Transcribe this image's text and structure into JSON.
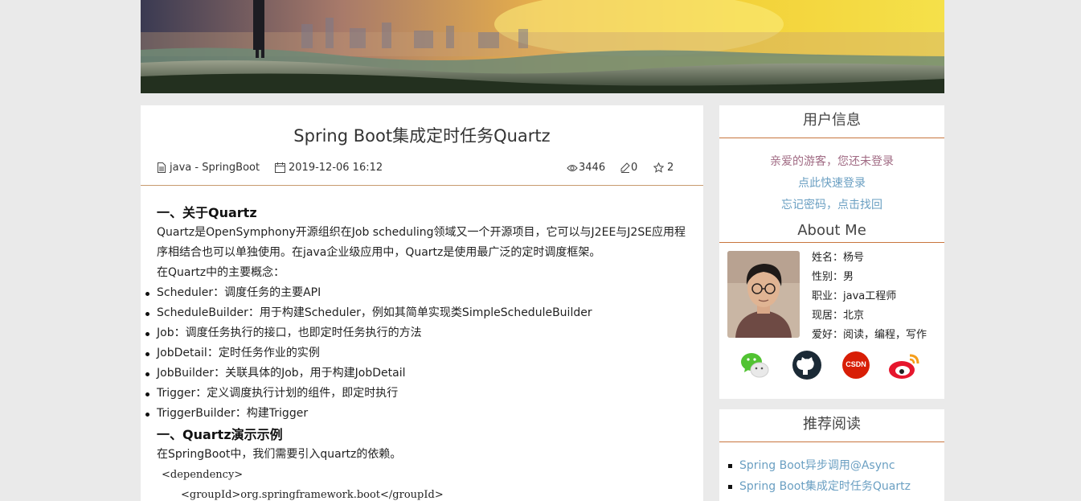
{
  "article": {
    "title": "Spring Boot集成定时任务Quartz",
    "category": "java - SpringBoot",
    "date": "2019-12-06 16:12",
    "views": "3446",
    "comments": "0",
    "likes": "2",
    "h1": "一、关于Quartz",
    "intro": "Quartz是OpenSymphony开源组织在Job scheduling领域又一个开源项目，它可以与J2EE与J2SE应用程序相结合也可以单独使用。在java企业级应用中，Quartz是使用最广泛的定时调度框架。",
    "concepts_label": "在Quartz中的主要概念：",
    "concepts": [
      "Scheduler：调度任务的主要API",
      "ScheduleBuilder：用于构建Scheduler，例如其简单实现类SimpleScheduleBuilder",
      "Job：调度任务执行的接口，也即定时任务执行的方法",
      "JobDetail：定时任务作业的实例",
      "JobBuilder：关联具体的Job，用于构建JobDetail",
      "Trigger：定义调度执行计划的组件，即定时执行",
      "TriggerBuilder：构建Trigger"
    ],
    "h2": "一、Quartz演示示例",
    "demo_text": "在SpringBoot中，我们需要引入quartz的依赖。",
    "code_line1": "<dependency>",
    "code_line2": "<groupId>org.springframework.boot</groupId>"
  },
  "user_info": {
    "heading": "用户信息",
    "greeting": "亲爱的游客，您还未登录",
    "login_link": "点此快速登录",
    "forgot_link": "忘记密码，点击找回"
  },
  "about": {
    "heading": "About Me",
    "name": "姓名：杨号",
    "gender": "性别：男",
    "job": "职业：java工程师",
    "location": "现居：北京",
    "hobbies": "爱好：阅读，编程，写作"
  },
  "socials": {
    "wechat": "wechat-icon",
    "github": "github-icon",
    "csdn": "CSDN",
    "weibo": "weibo-icon"
  },
  "recommend": {
    "heading": "推荐阅读",
    "items": [
      "Spring Boot异步调用@Async",
      "Spring Boot集成定时任务Quartz"
    ]
  }
}
